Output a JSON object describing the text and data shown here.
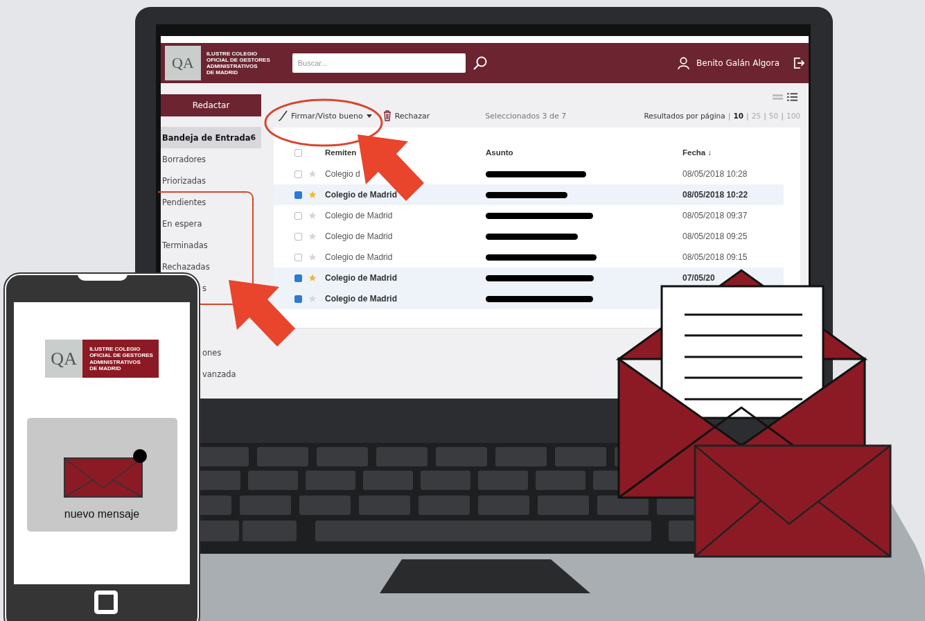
{
  "header": {
    "logo": {
      "mark": "QA",
      "lines": [
        "ILUSTRE COLEGIO",
        "OFICIAL DE GESTORES",
        "ADMINISTRATIVOS",
        "DE MADRID"
      ]
    },
    "search": {
      "placeholder": "Buscar..."
    },
    "user": "Benito Galán Algora"
  },
  "sidebar": {
    "compose": "Redactar",
    "items": [
      {
        "label": "Bandeja de Entrada",
        "count": "6",
        "selected": true,
        "kind": "full"
      },
      {
        "label": "Borradores",
        "selected": false,
        "kind": "full"
      },
      {
        "label": "Priorizadas",
        "selected": false,
        "kind": "full"
      },
      {
        "label": "Pendientes",
        "selected": false,
        "kind": "full"
      },
      {
        "label": "En espera",
        "selected": false,
        "kind": "full"
      },
      {
        "label": "Terminadas",
        "selected": false,
        "kind": "full"
      },
      {
        "label": "Rechazadas",
        "selected": false,
        "kind": "full"
      },
      {
        "label": "s",
        "selected": false,
        "kind": "partial"
      },
      {
        "label": "ones",
        "selected": false,
        "kind": "lower"
      },
      {
        "label": "vanzada",
        "selected": false,
        "kind": "partial"
      }
    ]
  },
  "toolbar": {
    "sign": "Firmar/Visto bueno",
    "reject": "Rechazar",
    "selection": "Seleccionados 3 de 7",
    "per_page_label": "Resultados por página",
    "per_page": [
      {
        "divider": "|",
        "label": "10",
        "selected": true
      },
      {
        "divider": "|",
        "label": "25",
        "selected": false
      },
      {
        "divider": "|",
        "label": "50",
        "selected": false
      },
      {
        "divider": "|",
        "label": "100",
        "selected": false
      }
    ]
  },
  "table": {
    "select_all": {
      "checked": false
    },
    "columns": [
      "Remiten",
      "Asunto",
      "Fecha ↓"
    ],
    "rows": [
      {
        "sender": "Colegio d",
        "selected": false,
        "starred": false,
        "unread": false,
        "date": "08/05/2018 10:28"
      },
      {
        "sender": "Colegio de Madrid",
        "selected": true,
        "starred": true,
        "unread": true,
        "date": "08/05/2018 10:22"
      },
      {
        "sender": "Colegio de Madrid",
        "selected": false,
        "starred": false,
        "unread": false,
        "date": "08/05/2018 09:37"
      },
      {
        "sender": "Colegio de Madrid",
        "selected": false,
        "starred": false,
        "unread": false,
        "date": "08/05/2018 09:25"
      },
      {
        "sender": "Colegio de Madrid",
        "selected": false,
        "starred": false,
        "unread": false,
        "date": "08/05/2018 09:15"
      },
      {
        "sender": "Colegio de Madrid",
        "selected": true,
        "starred": true,
        "unread": true,
        "date": "07/05/20"
      },
      {
        "sender": "Colegio de Madrid",
        "selected": true,
        "starred": false,
        "unread": true
      }
    ]
  },
  "phone": {
    "logo": {
      "mark": "QA",
      "lines": [
        "ILUSTRE COLEGIO",
        "OFICIAL DE GESTORES",
        "ADMINISTRATIVOS",
        "DE MADRID"
      ]
    },
    "notification": "nuevo mensaje"
  }
}
